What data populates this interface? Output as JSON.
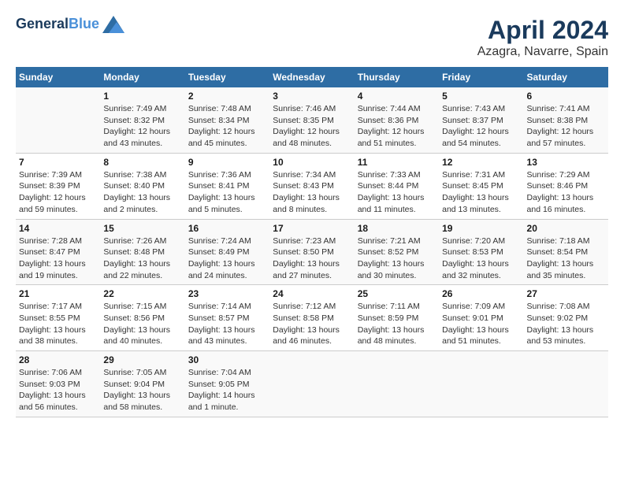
{
  "header": {
    "logo_line1": "General",
    "logo_line2": "Blue",
    "title": "April 2024",
    "subtitle": "Azagra, Navarre, Spain"
  },
  "columns": [
    "Sunday",
    "Monday",
    "Tuesday",
    "Wednesday",
    "Thursday",
    "Friday",
    "Saturday"
  ],
  "weeks": [
    [
      {
        "day": "",
        "info": ""
      },
      {
        "day": "1",
        "info": "Sunrise: 7:49 AM\nSunset: 8:32 PM\nDaylight: 12 hours\nand 43 minutes."
      },
      {
        "day": "2",
        "info": "Sunrise: 7:48 AM\nSunset: 8:34 PM\nDaylight: 12 hours\nand 45 minutes."
      },
      {
        "day": "3",
        "info": "Sunrise: 7:46 AM\nSunset: 8:35 PM\nDaylight: 12 hours\nand 48 minutes."
      },
      {
        "day": "4",
        "info": "Sunrise: 7:44 AM\nSunset: 8:36 PM\nDaylight: 12 hours\nand 51 minutes."
      },
      {
        "day": "5",
        "info": "Sunrise: 7:43 AM\nSunset: 8:37 PM\nDaylight: 12 hours\nand 54 minutes."
      },
      {
        "day": "6",
        "info": "Sunrise: 7:41 AM\nSunset: 8:38 PM\nDaylight: 12 hours\nand 57 minutes."
      }
    ],
    [
      {
        "day": "7",
        "info": "Sunrise: 7:39 AM\nSunset: 8:39 PM\nDaylight: 12 hours\nand 59 minutes."
      },
      {
        "day": "8",
        "info": "Sunrise: 7:38 AM\nSunset: 8:40 PM\nDaylight: 13 hours\nand 2 minutes."
      },
      {
        "day": "9",
        "info": "Sunrise: 7:36 AM\nSunset: 8:41 PM\nDaylight: 13 hours\nand 5 minutes."
      },
      {
        "day": "10",
        "info": "Sunrise: 7:34 AM\nSunset: 8:43 PM\nDaylight: 13 hours\nand 8 minutes."
      },
      {
        "day": "11",
        "info": "Sunrise: 7:33 AM\nSunset: 8:44 PM\nDaylight: 13 hours\nand 11 minutes."
      },
      {
        "day": "12",
        "info": "Sunrise: 7:31 AM\nSunset: 8:45 PM\nDaylight: 13 hours\nand 13 minutes."
      },
      {
        "day": "13",
        "info": "Sunrise: 7:29 AM\nSunset: 8:46 PM\nDaylight: 13 hours\nand 16 minutes."
      }
    ],
    [
      {
        "day": "14",
        "info": "Sunrise: 7:28 AM\nSunset: 8:47 PM\nDaylight: 13 hours\nand 19 minutes."
      },
      {
        "day": "15",
        "info": "Sunrise: 7:26 AM\nSunset: 8:48 PM\nDaylight: 13 hours\nand 22 minutes."
      },
      {
        "day": "16",
        "info": "Sunrise: 7:24 AM\nSunset: 8:49 PM\nDaylight: 13 hours\nand 24 minutes."
      },
      {
        "day": "17",
        "info": "Sunrise: 7:23 AM\nSunset: 8:50 PM\nDaylight: 13 hours\nand 27 minutes."
      },
      {
        "day": "18",
        "info": "Sunrise: 7:21 AM\nSunset: 8:52 PM\nDaylight: 13 hours\nand 30 minutes."
      },
      {
        "day": "19",
        "info": "Sunrise: 7:20 AM\nSunset: 8:53 PM\nDaylight: 13 hours\nand 32 minutes."
      },
      {
        "day": "20",
        "info": "Sunrise: 7:18 AM\nSunset: 8:54 PM\nDaylight: 13 hours\nand 35 minutes."
      }
    ],
    [
      {
        "day": "21",
        "info": "Sunrise: 7:17 AM\nSunset: 8:55 PM\nDaylight: 13 hours\nand 38 minutes."
      },
      {
        "day": "22",
        "info": "Sunrise: 7:15 AM\nSunset: 8:56 PM\nDaylight: 13 hours\nand 40 minutes."
      },
      {
        "day": "23",
        "info": "Sunrise: 7:14 AM\nSunset: 8:57 PM\nDaylight: 13 hours\nand 43 minutes."
      },
      {
        "day": "24",
        "info": "Sunrise: 7:12 AM\nSunset: 8:58 PM\nDaylight: 13 hours\nand 46 minutes."
      },
      {
        "day": "25",
        "info": "Sunrise: 7:11 AM\nSunset: 8:59 PM\nDaylight: 13 hours\nand 48 minutes."
      },
      {
        "day": "26",
        "info": "Sunrise: 7:09 AM\nSunset: 9:01 PM\nDaylight: 13 hours\nand 51 minutes."
      },
      {
        "day": "27",
        "info": "Sunrise: 7:08 AM\nSunset: 9:02 PM\nDaylight: 13 hours\nand 53 minutes."
      }
    ],
    [
      {
        "day": "28",
        "info": "Sunrise: 7:06 AM\nSunset: 9:03 PM\nDaylight: 13 hours\nand 56 minutes."
      },
      {
        "day": "29",
        "info": "Sunrise: 7:05 AM\nSunset: 9:04 PM\nDaylight: 13 hours\nand 58 minutes."
      },
      {
        "day": "30",
        "info": "Sunrise: 7:04 AM\nSunset: 9:05 PM\nDaylight: 14 hours\nand 1 minute."
      },
      {
        "day": "",
        "info": ""
      },
      {
        "day": "",
        "info": ""
      },
      {
        "day": "",
        "info": ""
      },
      {
        "day": "",
        "info": ""
      }
    ]
  ]
}
